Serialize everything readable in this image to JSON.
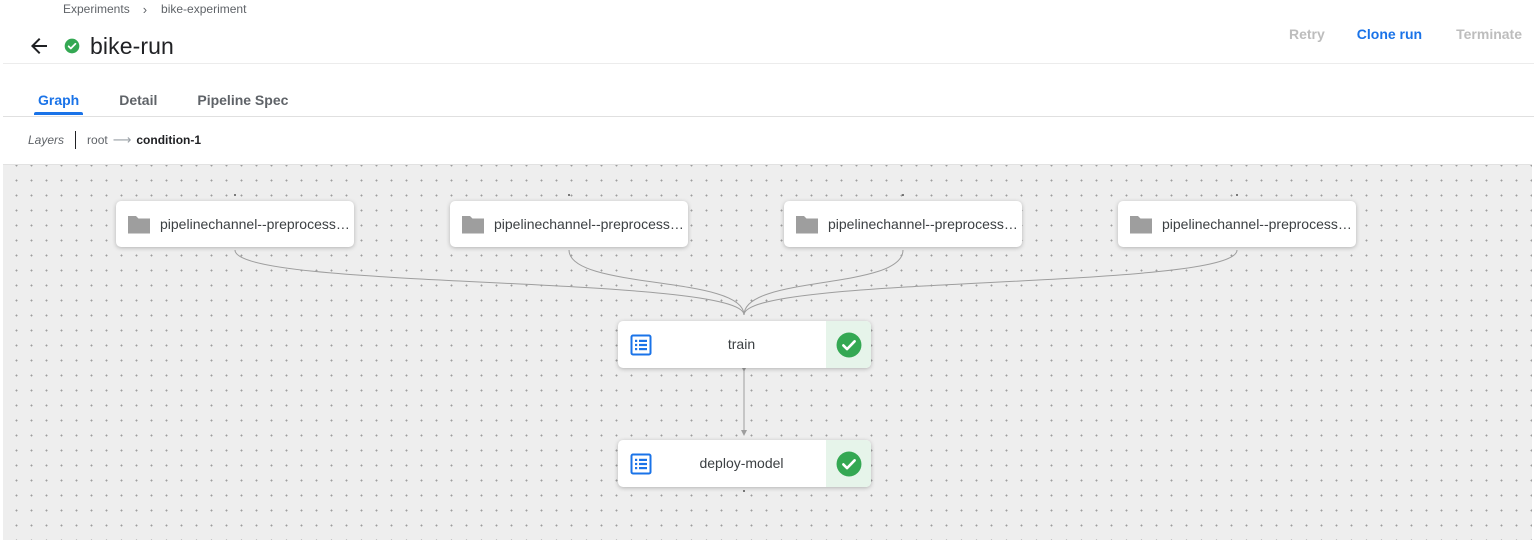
{
  "breadcrumb": {
    "items": [
      "Experiments",
      "bike-experiment"
    ],
    "separator": "›"
  },
  "run": {
    "title": "bike-run",
    "status": "succeeded",
    "status_icon": "check-circle-icon",
    "status_color": "#34a853"
  },
  "actions": {
    "retry_label": "Retry",
    "clone_label": "Clone run",
    "terminate_label": "Terminate"
  },
  "tabs": [
    {
      "label": "Graph",
      "active": true
    },
    {
      "label": "Detail",
      "active": false
    },
    {
      "label": "Pipeline Spec",
      "active": false
    }
  ],
  "layers": {
    "label": "Layers",
    "path": [
      "root",
      "condition-1"
    ],
    "arrow": "⟶"
  },
  "graph": {
    "channel_nodes": [
      {
        "label": "pipelinechannel--preprocess-...",
        "icon": "folder-icon"
      },
      {
        "label": "pipelinechannel--preprocess-...",
        "icon": "folder-icon"
      },
      {
        "label": "pipelinechannel--preprocess-...",
        "icon": "folder-icon"
      },
      {
        "label": "pipelinechannel--preprocess-...",
        "icon": "folder-icon"
      }
    ],
    "task_nodes": [
      {
        "label": "train",
        "status": "succeeded",
        "icon": "task-list-icon"
      },
      {
        "label": "deploy-model",
        "status": "succeeded",
        "icon": "task-list-icon"
      }
    ]
  },
  "colors": {
    "accent": "#1a73e8",
    "success": "#34a853",
    "success_bg": "#e6f4ea",
    "disabled": "#bdbdbd",
    "canvas_bg": "#eeeeee",
    "folder": "#9e9e9e",
    "edge": "#9e9e9e"
  }
}
